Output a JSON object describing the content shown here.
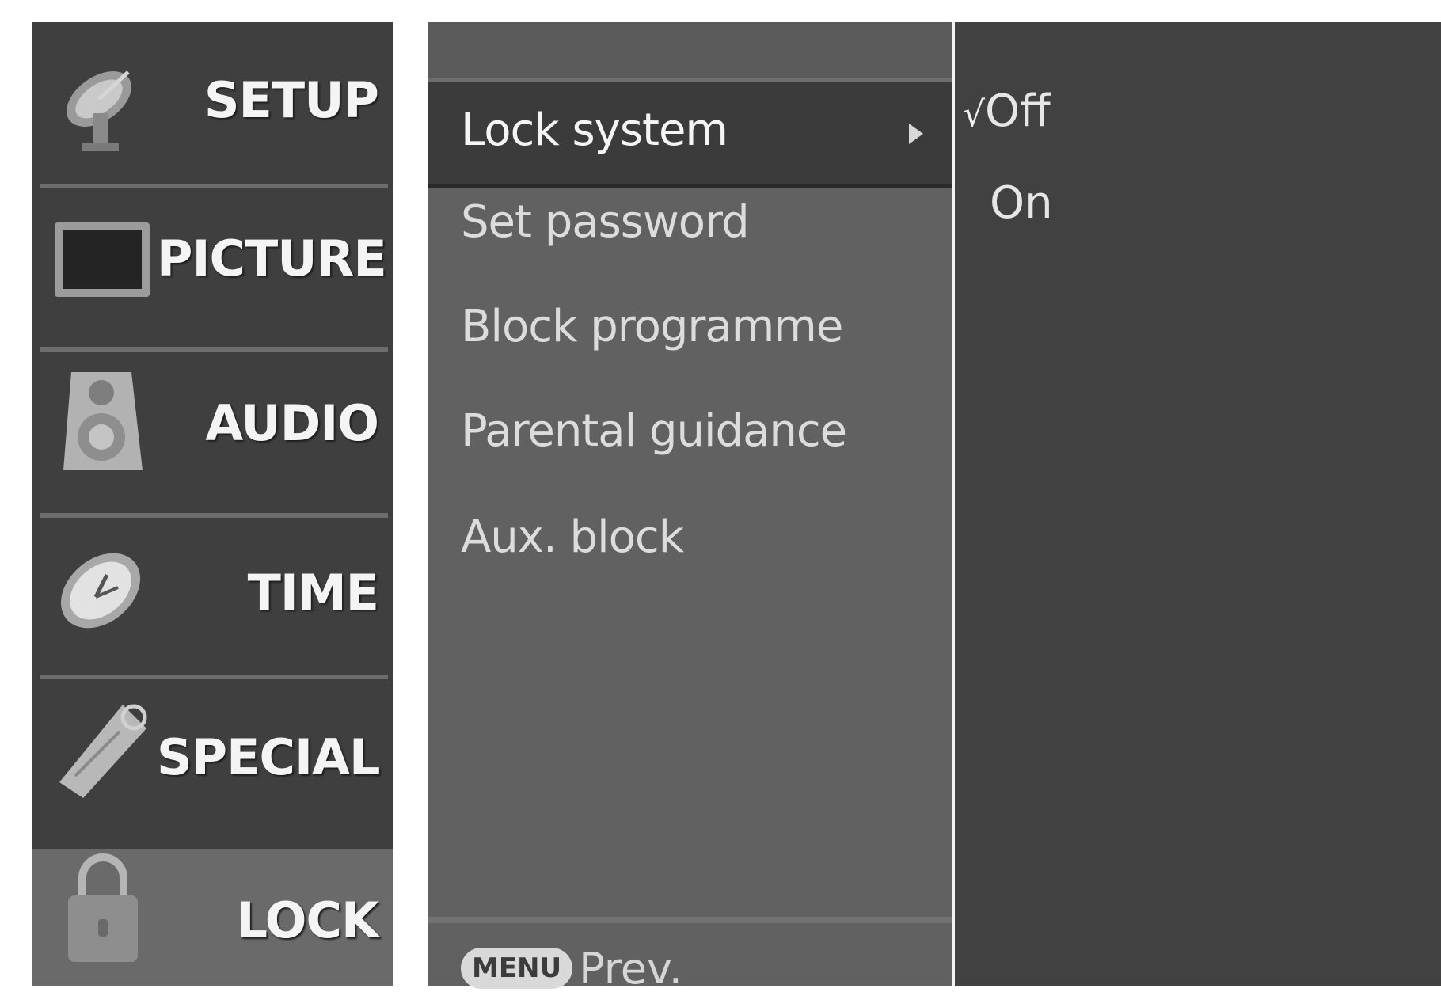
{
  "sidebar": {
    "items": [
      {
        "label": "SETUP",
        "icon": "satellite-dish-icon",
        "selected": false
      },
      {
        "label": "PICTURE",
        "icon": "tv-screen-icon",
        "selected": false
      },
      {
        "label": "AUDIO",
        "icon": "speaker-icon",
        "selected": false
      },
      {
        "label": "TIME",
        "icon": "clock-icon",
        "selected": false
      },
      {
        "label": "SPECIAL",
        "icon": "tag-icon",
        "selected": false
      },
      {
        "label": "LOCK",
        "icon": "padlock-icon",
        "selected": true
      }
    ]
  },
  "menu": {
    "items": [
      {
        "label": "Lock system",
        "active": true
      },
      {
        "label": "Set password",
        "active": false
      },
      {
        "label": "Block programme",
        "active": false
      },
      {
        "label": "Parental guidance",
        "active": false
      },
      {
        "label": "Aux. block",
        "active": false
      }
    ],
    "footer_key": "MENU",
    "footer_text": "Prev."
  },
  "options": {
    "items": [
      {
        "label": "Off",
        "checked": true,
        "check_mark": "√"
      },
      {
        "label": "On",
        "checked": false
      }
    ]
  },
  "colors": {
    "sidebar_bg": "#3f3f3f",
    "sidebar_selected_bg": "#6a6a6a",
    "menu_bg": "#616161",
    "menu_selected_bg": "#3b3b3b",
    "options_bg": "#414141"
  }
}
